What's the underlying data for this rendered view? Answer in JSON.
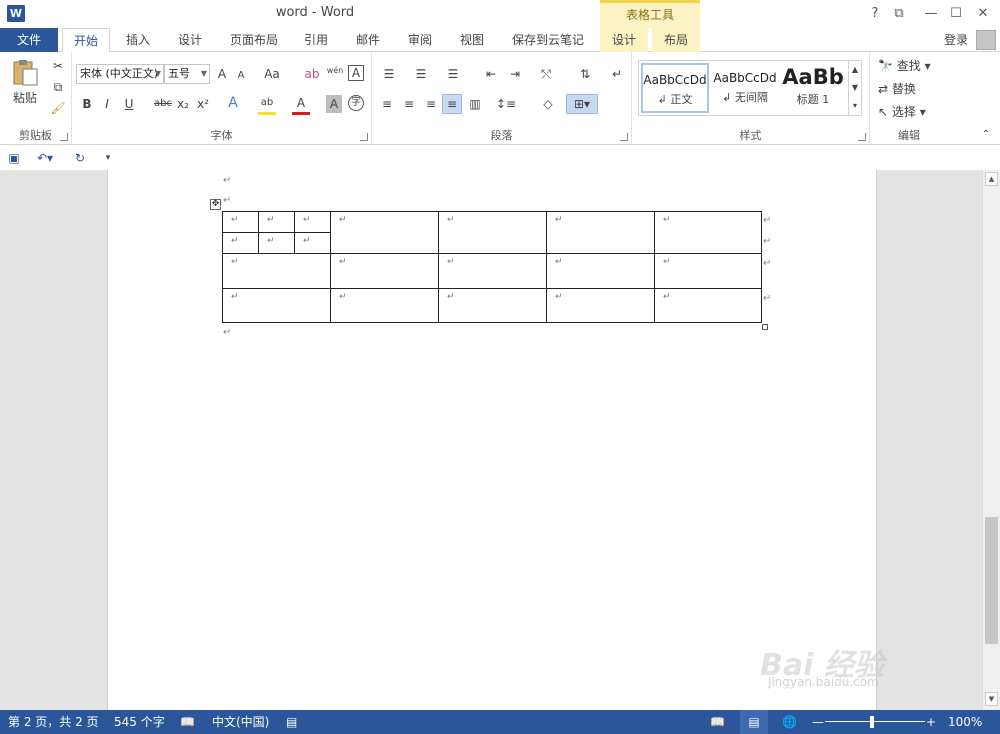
{
  "titlebar": {
    "app_icon": "W",
    "title": "word - Word",
    "contextual_tools": "表格工具",
    "controls": [
      "?",
      "⧉",
      "—",
      "☐",
      "✕"
    ]
  },
  "tabs": {
    "file": "文件",
    "items": [
      "开始",
      "插入",
      "设计",
      "页面布局",
      "引用",
      "邮件",
      "审阅",
      "视图",
      "保存到云笔记"
    ],
    "context_items": [
      "设计",
      "布局"
    ],
    "login": "登录"
  },
  "ribbon": {
    "clipboard": {
      "paste": "粘贴",
      "label": "剪贴板"
    },
    "font": {
      "font_name": "宋体 (中文正文)",
      "font_size": "五号",
      "label": "字体",
      "buttons": [
        "A",
        "A",
        "Aa",
        "ab",
        "wén",
        "A",
        "B",
        "I",
        "U",
        "abc",
        "x₂",
        "x²",
        "A",
        "ab",
        "A",
        "A",
        "字"
      ]
    },
    "paragraph": {
      "label": "段落"
    },
    "styles": {
      "label": "样式",
      "items": [
        {
          "sample": "AaBbCcDd",
          "name": "↲ 正文"
        },
        {
          "sample": "AaBbCcDd",
          "name": "↲ 无间隔"
        },
        {
          "sample": "AaBb",
          "name": "标题 1"
        }
      ]
    },
    "editing": {
      "label": "编辑",
      "find": "查找",
      "replace": "替换",
      "select": "选择"
    }
  },
  "qat": {
    "icons": [
      "save-icon",
      "undo-icon",
      "redo-icon",
      "customize-icon"
    ]
  },
  "document": {
    "para_mark": "↵",
    "table": {
      "rows": 3,
      "cols": 5,
      "first_cell_split": "2x3"
    }
  },
  "watermark": {
    "main": "Bai 经验",
    "sub": "jingyan.baidu.com"
  },
  "statusbar": {
    "page": "第 2 页，共 2 页",
    "words": "545 个字",
    "language": "中文(中国)",
    "zoom": "100%",
    "zoom_minus": "—",
    "zoom_plus": "+"
  }
}
